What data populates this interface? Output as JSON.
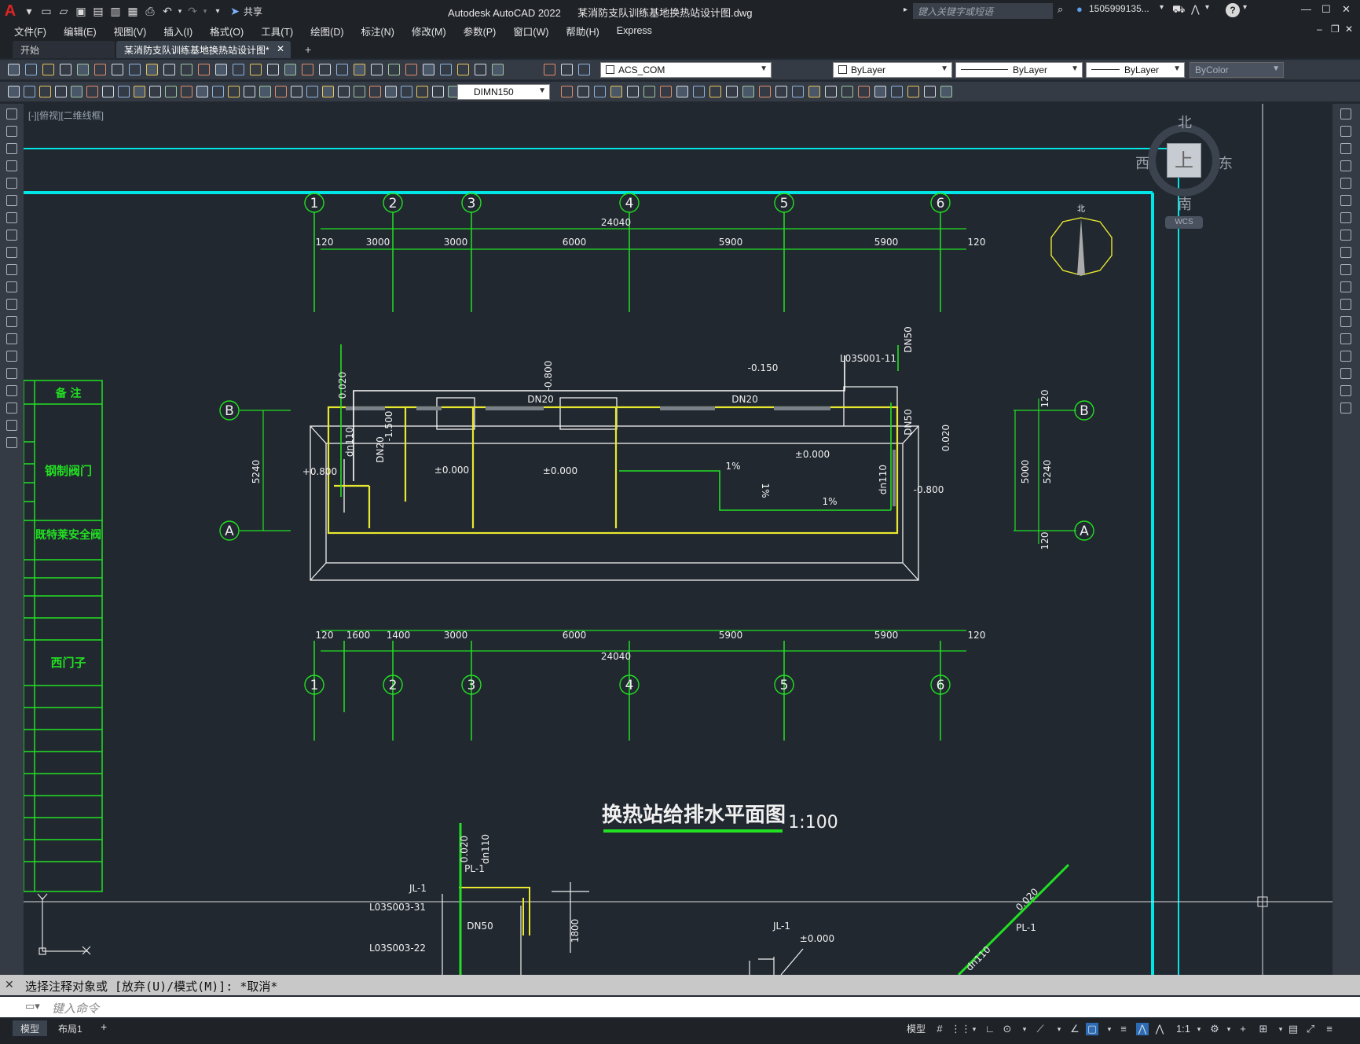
{
  "app": {
    "product": "Autodesk AutoCAD 2022",
    "filename": "某消防支队训练基地换热站设计图.dwg",
    "share_label": "共享",
    "search_placeholder": "键入关键字或短语",
    "user": "1505999135...",
    "help": "?"
  },
  "menu": [
    "文件(F)",
    "编辑(E)",
    "视图(V)",
    "插入(I)",
    "格式(O)",
    "工具(T)",
    "绘图(D)",
    "标注(N)",
    "修改(M)",
    "参数(P)",
    "窗口(W)",
    "帮助(H)",
    "Express"
  ],
  "tabs": {
    "start": "开始",
    "drawing": "某消防支队训练基地换热站设计图*"
  },
  "toolbar": {
    "textstyle": "ACS_COM",
    "layer_color": "ByLayer",
    "linetype": "ByLayer",
    "lineweight": "ByLayer",
    "plotstyle": "ByColor",
    "dimstyle": "DIMN150"
  },
  "viewport_label": "[-][俯视][二维线框]",
  "viewcube": {
    "north": "北",
    "south": "南",
    "east": "东",
    "west": "西",
    "top": "上",
    "wcs": "WCS"
  },
  "drawing": {
    "title": "换热站给排水平面图",
    "scale": "1:100",
    "north_label": "北",
    "axis_numbers": [
      "1",
      "2",
      "3",
      "4",
      "5",
      "6"
    ],
    "axis_letters": [
      "B",
      "A"
    ],
    "top_dims": [
      "120",
      "3000",
      "3000",
      "6000",
      "5900",
      "5900",
      "120"
    ],
    "top_total": "24040",
    "bottom_dims": [
      "120",
      "1600",
      "1400",
      "3000",
      "6000",
      "5900",
      "5900",
      "120"
    ],
    "bottom_total": "24040",
    "left_dim": "5240",
    "right_dims": [
      "120",
      "5000",
      "5240",
      "120"
    ],
    "pipe_labels": [
      "DN20",
      "DN20",
      "DN50",
      "DN50",
      "DN20",
      "dn110",
      "dn110"
    ],
    "elevations": [
      "-0.150",
      "±0.000",
      "±0.000",
      "±0.000",
      "+0.800",
      "-0.800",
      "-0.800",
      "-1.500",
      "0.020",
      "0.020"
    ],
    "slopes": [
      "1%",
      "1%",
      "1%"
    ],
    "code_label": "L03S001-11",
    "legend_header": "备    注",
    "legend_items": [
      "钢制阀门",
      "既特莱安全阀",
      "西门子"
    ],
    "lower_labels": [
      "PL-1",
      "JL-1",
      "L03S003-31",
      "L03S003-22",
      "DN50",
      "1800",
      "JL-1",
      "±0.000",
      "PL-1",
      "0.020",
      "dn110",
      "dn110",
      "0.020"
    ]
  },
  "command": {
    "history": "选择注释对象或 [放弃(U)/模式(M)]: *取消*",
    "placeholder": "键入命令"
  },
  "status": {
    "tab_model": "模型",
    "tab_layout": "布局1",
    "model_label": "模型",
    "scale": "1:1"
  }
}
